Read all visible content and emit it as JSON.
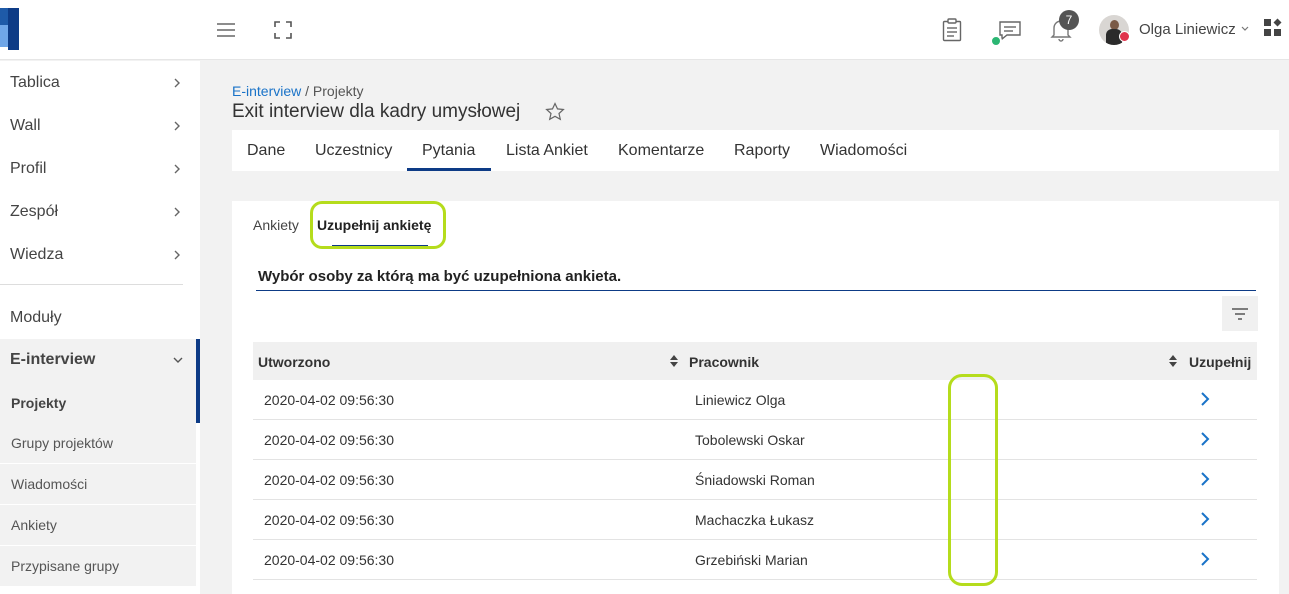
{
  "topbar": {
    "notifications_count": "7",
    "user_name": "Olga Liniewicz"
  },
  "sidebar": {
    "items": [
      {
        "label": "Tablica"
      },
      {
        "label": "Wall"
      },
      {
        "label": "Profil"
      },
      {
        "label": "Zespół"
      },
      {
        "label": "Wiedza"
      }
    ],
    "modules_label": "Moduły",
    "einterview_label": "E-interview",
    "sub_items": [
      {
        "label": "Projekty",
        "active": true
      },
      {
        "label": "Grupy projektów"
      },
      {
        "label": "Wiadomości"
      },
      {
        "label": "Ankiety"
      },
      {
        "label": "Przypisane grupy"
      }
    ]
  },
  "breadcrumb": {
    "link": "E-interview",
    "separator": " / ",
    "current": "Projekty"
  },
  "page_title": "Exit interview dla kadry umysłowej",
  "tabs": [
    {
      "label": "Dane"
    },
    {
      "label": "Uczestnicy"
    },
    {
      "label": "Pytania",
      "active": true
    },
    {
      "label": "Lista Ankiet"
    },
    {
      "label": "Komentarze"
    },
    {
      "label": "Raporty"
    },
    {
      "label": "Wiadomości"
    }
  ],
  "subtabs": {
    "ankiety": "Ankiety",
    "uzupelnij": "Uzupełnij ankietę"
  },
  "section_title": "Wybór osoby za którą ma być uzupełniona ankieta.",
  "table": {
    "columns": [
      "Utworzono",
      "Pracownik",
      "Uzupełnij"
    ],
    "rows": [
      [
        "2020-04-02 09:56:30",
        "Liniewicz Olga"
      ],
      [
        "2020-04-02 09:56:30",
        "Tobolewski Oskar"
      ],
      [
        "2020-04-02 09:56:30",
        "Śniadowski Roman"
      ],
      [
        "2020-04-02 09:56:30",
        "Machaczka Łukasz"
      ],
      [
        "2020-04-02 09:56:30",
        "Grzebiński Marian"
      ]
    ]
  },
  "colors": {
    "accent": "#0d3b86",
    "link": "#1a73c8",
    "highlight": "#b5dc1c"
  }
}
